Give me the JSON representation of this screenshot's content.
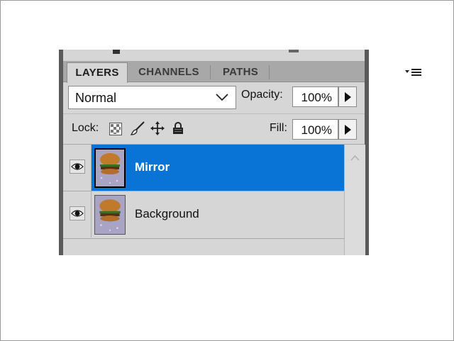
{
  "panel": {
    "tabs": [
      {
        "label": "LAYERS",
        "active": true
      },
      {
        "label": "CHANNELS",
        "active": false
      },
      {
        "label": "PATHS",
        "active": false
      }
    ],
    "menu_icon": "panel-menu-icon",
    "blend_mode": "Normal",
    "opacity_label": "Opacity:",
    "opacity_value": "100%",
    "lock_label": "Lock:",
    "fill_label": "Fill:",
    "fill_value": "100%",
    "layers": [
      {
        "name": "Mirror",
        "selected": true,
        "visible": true
      },
      {
        "name": "Background",
        "selected": false,
        "visible": true
      }
    ]
  },
  "colors": {
    "selection": "#0a74d6",
    "panel_bg": "#d6d6d6",
    "tab_bar": "#a8a8a8"
  }
}
